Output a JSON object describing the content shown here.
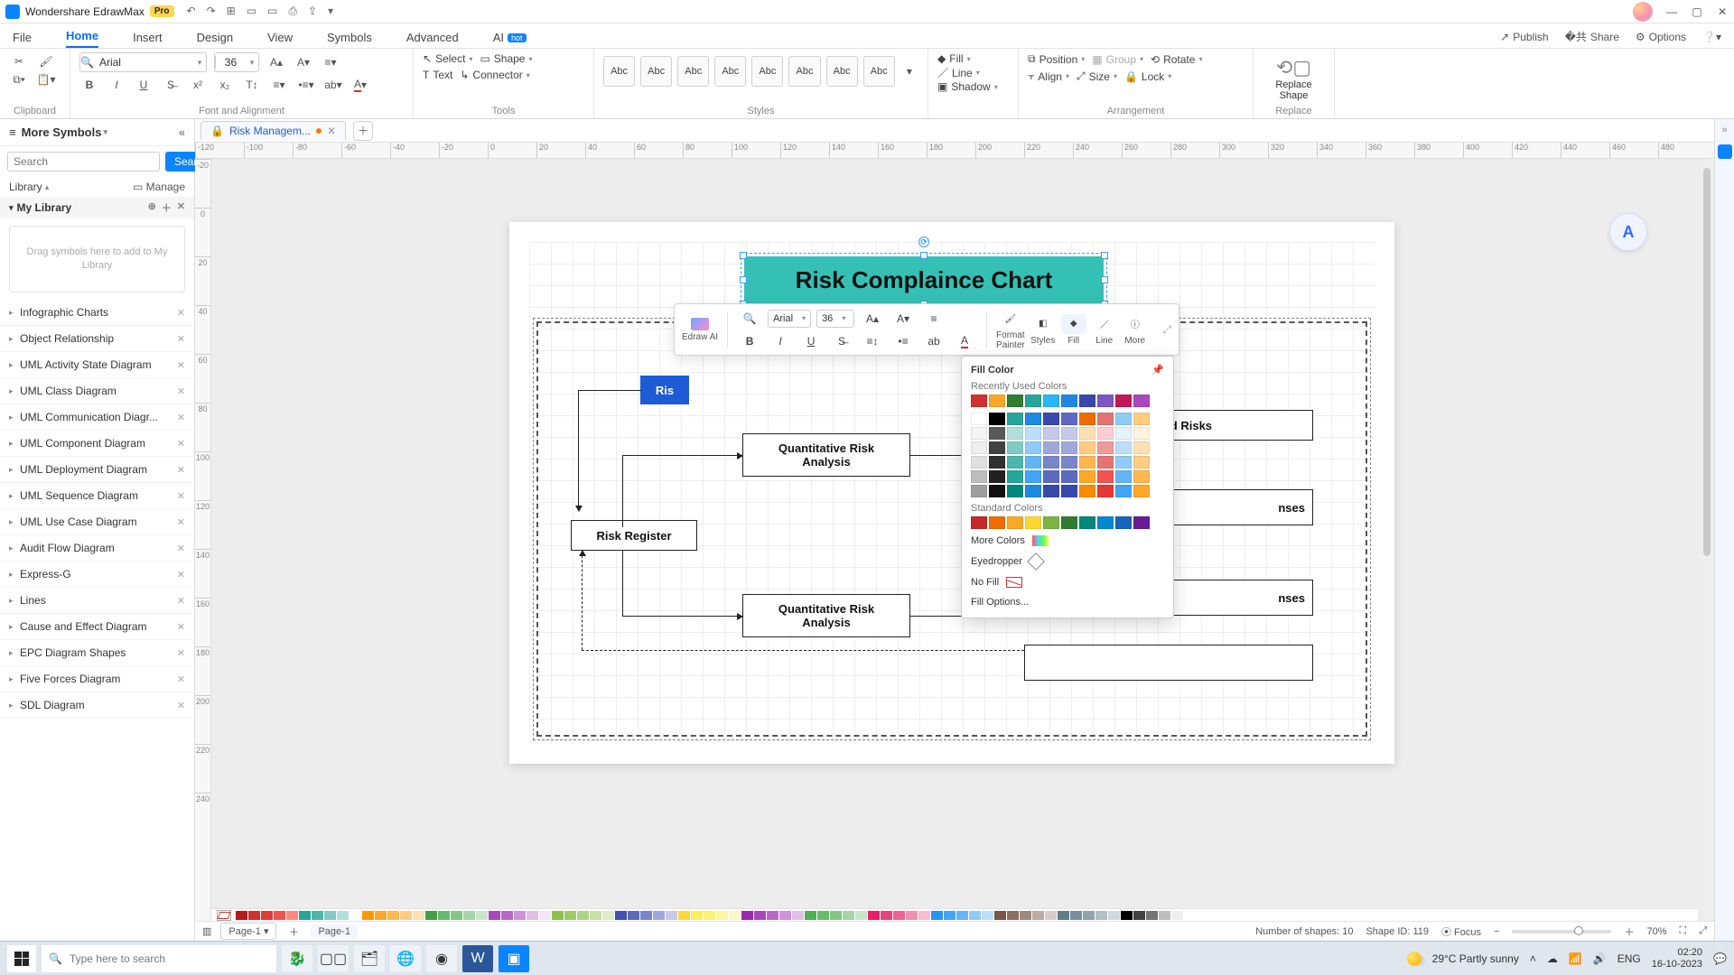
{
  "app": {
    "name": "Wondershare EdrawMax",
    "badge": "Pro"
  },
  "window": {
    "minimize": "—",
    "maximize": "▢",
    "close": "✕"
  },
  "qat": {
    "undo": "↶",
    "redo": "↷",
    "new": "⊞",
    "open": "▭",
    "save": "▭",
    "print": "⎙",
    "export": "⇪",
    "more": "▾"
  },
  "menu": {
    "file": "File",
    "home": "Home",
    "insert": "Insert",
    "design": "Design",
    "view": "View",
    "symbols": "Symbols",
    "advanced": "Advanced",
    "ai": "AI",
    "hot": "hot"
  },
  "toplinks": {
    "publish": "Publish",
    "share": "Share",
    "options": "Options"
  },
  "ribbon": {
    "clipboard": "Clipboard",
    "fontalign": "Font and Alignment",
    "tools": "Tools",
    "styles": "Styles",
    "arrangement": "Arrangement",
    "replace": "Replace",
    "font_name": "Arial",
    "font_size": "36",
    "select": "Select",
    "shape": "Shape",
    "text": "Text",
    "connector": "Connector",
    "stylecard": "Abc",
    "fill": "Fill",
    "line": "Line",
    "shadow": "Shadow",
    "position": "Position",
    "group": "Group",
    "rotate": "Rotate",
    "align": "Align",
    "size": "Size",
    "lock": "Lock",
    "replace_shape": "Replace\nShape"
  },
  "left": {
    "more": "More Symbols",
    "search_ph": "Search",
    "search_btn": "Search",
    "library": "Library",
    "manage": "Manage",
    "mylib": "My Library",
    "dropzone": "Drag symbols here to add to My Library",
    "cats": [
      "Infographic Charts",
      "Object Relationship",
      "UML Activity State Diagram",
      "UML Class Diagram",
      "UML Communication Diagr...",
      "UML Component Diagram",
      "UML Deployment Diagram",
      "UML Sequence Diagram",
      "UML Use Case Diagram",
      "Audit Flow Diagram",
      "Express-G",
      "Lines",
      "Cause and Effect Diagram",
      "EPC Diagram Shapes",
      "Five Forces Diagram",
      "SDL Diagram"
    ]
  },
  "doc": {
    "tab": "Risk Managem...",
    "page_label": "Page-1"
  },
  "ruler_h": [
    "-120",
    "-100",
    "-80",
    "-60",
    "-40",
    "-20",
    "0",
    "20",
    "40",
    "60",
    "80",
    "100",
    "120",
    "140",
    "160",
    "180",
    "200",
    "220",
    "240",
    "260",
    "280",
    "300",
    "320",
    "340",
    "360",
    "380",
    "400",
    "420",
    "440",
    "460",
    "480"
  ],
  "ruler_v": [
    "-20",
    "0",
    "20",
    "40",
    "60",
    "80",
    "100",
    "120",
    "140",
    "160",
    "180",
    "200",
    "220",
    "240"
  ],
  "chart": {
    "title": "Risk Complaince Chart",
    "risk_label": "Ris",
    "qra": "Quantitative Risk\nAnalysis",
    "register": "Risk Register",
    "selected": "…elected Risks",
    "nses1": "nses",
    "nses2": "nses"
  },
  "mini": {
    "edrawai": "Edraw AI",
    "font": "Arial",
    "size": "36",
    "format_painter": "Format\nPainter",
    "styles": "Styles",
    "fill": "Fill",
    "line": "Line",
    "more": "More"
  },
  "fillpop": {
    "title": "Fill Color",
    "recent": "Recently Used Colors",
    "standard": "Standard Colors",
    "more": "More Colors",
    "eyedrop": "Eyedropper",
    "nofill": "No Fill",
    "options": "Fill Options...",
    "recent_colors": [
      "#d32f2f",
      "#f9a825",
      "#2e7d32",
      "#26a69a",
      "#29b6f6",
      "#1e88e5",
      "#3949ab",
      "#7e57c2",
      "#c2185b",
      "#ab47bc"
    ],
    "theme_head": [
      "#ffffff",
      "#000000",
      "#26a69a",
      "#1e88e5",
      "#3949ab",
      "#5c6bc0",
      "#ef6c00",
      "#e57373",
      "#90caf9",
      "#ffcc80"
    ],
    "theme_grid": [
      [
        "#f5f5f5",
        "#595959",
        "#b2dfdb",
        "#bbdefb",
        "#c5cae9",
        "#c5cae9",
        "#ffe0b2",
        "#ffcdd2",
        "#e3f2fd",
        "#fff3e0"
      ],
      [
        "#eeeeee",
        "#424242",
        "#80cbc4",
        "#90caf9",
        "#9fa8da",
        "#9fa8da",
        "#ffcc80",
        "#ef9a9a",
        "#bbdefb",
        "#ffe0b2"
      ],
      [
        "#e0e0e0",
        "#303030",
        "#4db6ac",
        "#64b5f6",
        "#7986cb",
        "#7986cb",
        "#ffb74d",
        "#e57373",
        "#90caf9",
        "#ffcc80"
      ],
      [
        "#bdbdbd",
        "#212121",
        "#26a69a",
        "#42a5f5",
        "#5c6bc0",
        "#5c6bc0",
        "#ffa726",
        "#ef5350",
        "#64b5f6",
        "#ffb74d"
      ],
      [
        "#9e9e9e",
        "#111111",
        "#00897b",
        "#1e88e5",
        "#3949ab",
        "#3949ab",
        "#fb8c00",
        "#e53935",
        "#42a5f5",
        "#ffa726"
      ]
    ],
    "standard_colors": [
      "#c62828",
      "#ef6c00",
      "#f9a825",
      "#fdd835",
      "#7cb342",
      "#2e7d32",
      "#00897b",
      "#0288d1",
      "#1565c0",
      "#6a1b9a"
    ]
  },
  "colorstrip": [
    "#b71c1c",
    "#d32f2f",
    "#e53935",
    "#ef5350",
    "#ff8a80",
    "#26a69a",
    "#4db6ac",
    "#80cbc4",
    "#b2dfdb",
    "#ffffff",
    "#ff9800",
    "#ffa726",
    "#ffb74d",
    "#ffcc80",
    "#ffe0b2",
    "#43a047",
    "#66bb6a",
    "#81c784",
    "#a5d6a7",
    "#c8e6c9",
    "#ab47bc",
    "#ba68c8",
    "#ce93d8",
    "#e1bee7",
    "#f3e5f5",
    "#8bc34a",
    "#9ccc65",
    "#aed581",
    "#c5e1a5",
    "#dcedc8",
    "#3f51b5",
    "#5c6bc0",
    "#7986cb",
    "#9fa8da",
    "#c5cae9",
    "#fdd835",
    "#ffee58",
    "#fff176",
    "#fff59d",
    "#fff9c4",
    "#9c27b0",
    "#ab47bc",
    "#ba68c8",
    "#ce93d8",
    "#e1bee7",
    "#4caf50",
    "#66bb6a",
    "#81c784",
    "#a5d6a7",
    "#c8e6c9",
    "#e91e63",
    "#ec407a",
    "#f06292",
    "#f48fb1",
    "#f8bbd0",
    "#2196f3",
    "#42a5f5",
    "#64b5f6",
    "#90caf9",
    "#bbdefb",
    "#795548",
    "#8d6e63",
    "#a1887f",
    "#bcaaa4",
    "#d7ccc8",
    "#607d8b",
    "#78909c",
    "#90a4ae",
    "#b0bec5",
    "#cfd8dc",
    "#000000",
    "#424242",
    "#757575",
    "#bdbdbd",
    "#eeeeee",
    "#ffffff"
  ],
  "status": {
    "shapes": "Number of shapes: 10",
    "shapeid": "Shape ID: 119",
    "focus": "Focus",
    "zoom": "70%"
  },
  "taskbar": {
    "search_ph": "Type here to search",
    "weather": "29°C  Partly sunny",
    "lang": "ENG",
    "time": "02:20",
    "date": "16-10-2023"
  }
}
